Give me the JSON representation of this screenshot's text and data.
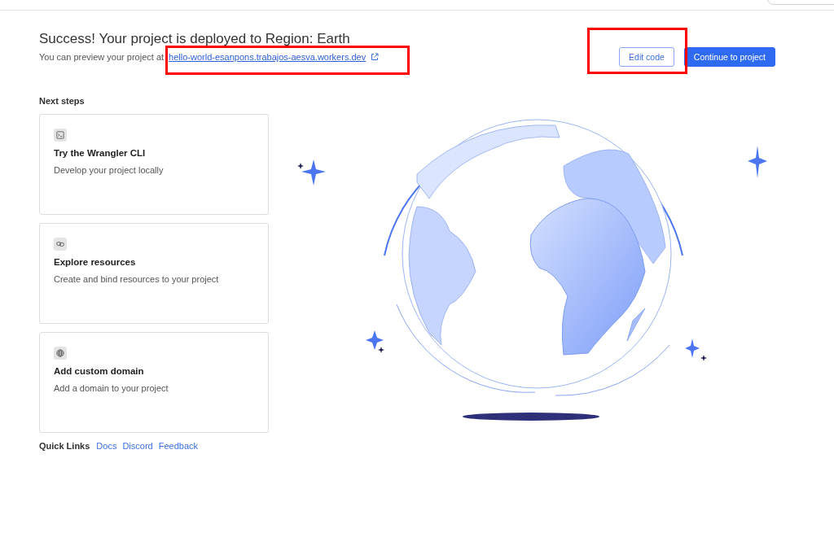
{
  "header": {
    "title": "Success! Your project is deployed to Region: Earth",
    "preview_text": "You can preview your project at",
    "preview_link": "hello-world-esanpons.trabajos-aesva.workers.dev"
  },
  "buttons": [
    {
      "label": "Edit code",
      "kind": "secondary"
    },
    {
      "label": "Continue to project",
      "kind": "primary"
    }
  ],
  "next_steps": {
    "title": "Next steps",
    "cards": [
      {
        "kind": "terminal",
        "title": "Try the Wrangler CLI",
        "description": "Develop your project locally"
      },
      {
        "kind": "link",
        "title": "Explore resources",
        "description": "Create and bind resources to your project"
      },
      {
        "kind": "globe",
        "title": "Add custom domain",
        "description": "Add a domain to your project"
      }
    ]
  },
  "quick_links": {
    "label": "Quick Links",
    "links": [
      "Docs",
      "Discord",
      "Feedback"
    ]
  }
}
